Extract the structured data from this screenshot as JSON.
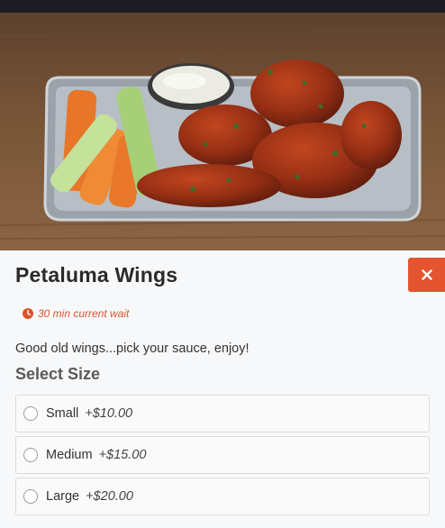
{
  "item": {
    "title": "Petaluma Wings",
    "wait_text": "30 min current wait",
    "description": "Good old wings...pick your sauce, enjoy!",
    "image_alt": "Plate of buffalo wings with carrots, celery and ranch dip"
  },
  "actions": {
    "close_symbol": "×"
  },
  "size_section": {
    "title": "Select Size",
    "options": [
      {
        "label": "Small",
        "price": "+$10.00",
        "selected": false
      },
      {
        "label": "Medium",
        "price": "+$15.00",
        "selected": false
      },
      {
        "label": "Large",
        "price": "+$20.00",
        "selected": false
      }
    ]
  },
  "colors": {
    "accent": "#e4542e",
    "wait_text": "#d9532b",
    "background": "#f7f8fa"
  },
  "icons": {
    "close": "close-icon",
    "clock": "clock-icon",
    "radio": "radio-icon"
  }
}
